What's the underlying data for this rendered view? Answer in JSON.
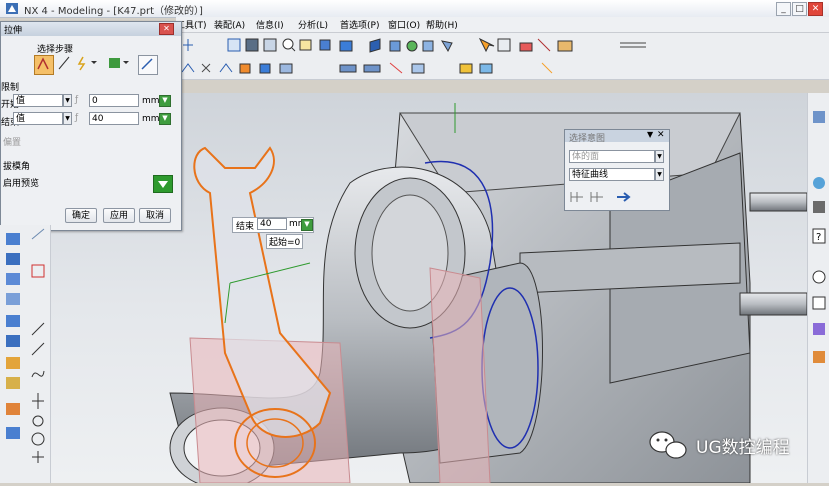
{
  "window": {
    "title": "NX 4 - Modeling - [K47.prt（修改的）]",
    "controls": [
      "_",
      "□",
      "✕"
    ]
  },
  "menubar": {
    "items": [
      "工具(T)",
      "装配(A)",
      "信息(I)",
      "分析(L)",
      "首选项(P)",
      "窗口(O)",
      "帮助(H)"
    ]
  },
  "extrude_dialog": {
    "title": "拉伸",
    "section_steps": "选择步骤",
    "limits_label": "限制",
    "start_label": "开始",
    "start_type": "值",
    "start_value": "0",
    "end_label": "结束",
    "end_type": "值",
    "end_value": "40",
    "unit": "mm",
    "offset_label": "偏置",
    "draft_label": "拔模角",
    "preview_label": "启用预览",
    "ok": "确定",
    "apply": "应用",
    "cancel": "取消"
  },
  "selection_popup": {
    "title": "选择意图",
    "option_top": "体的面",
    "option_feature": "特征曲线"
  },
  "onscreen": {
    "end_label": "结束",
    "end_value": "40",
    "unit": "mm",
    "start_text": "起始=0"
  },
  "watermark": {
    "text": "UG数控编程"
  },
  "colors": {
    "highlight_orange": "#e8731a",
    "body_gray": "#b7bbc0",
    "edge_blue": "#1f2fb0",
    "preview_pink": "#e9b5b8",
    "ok_green": "#2e9a2e"
  }
}
